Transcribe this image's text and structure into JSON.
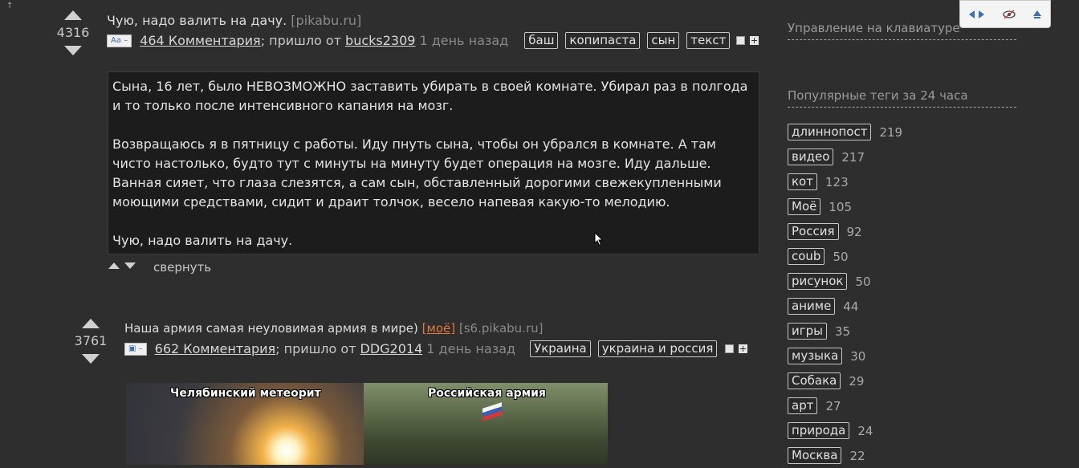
{
  "posts": [
    {
      "score": "4316",
      "title": "Чую, надо валить на дачу.",
      "source": "[pikabu.ru]",
      "type_badge": "Aa –",
      "comments": "464 Комментария",
      "from_text": "; пришло от",
      "author": "bucks2309",
      "time": "1 день назад",
      "tags": [
        "баш",
        "копипаста",
        "сын",
        "текст"
      ],
      "body": [
        "Сына, 16 лет, было НЕВОЗМОЖНО заставить убирать в своей комнате. Убирал раз в полгода и то только после интенсивного капания на мозг.",
        "Возвращаюсь я в пятницу с работы. Иду пнуть сына, чтобы он убрался в комнате. А там чисто настолько, будто тут с минуты на минуту будет операция на мозге. Иду дальше. Ванная сияет, что глаза слезятся, а сам сын, обставленный дорогими свежекупленными моющими средствами, сидит и драит толчок, весело напевая какую-то мелодию.",
        "Чую, надо валить на дачу."
      ],
      "collapse": "свернуть"
    },
    {
      "score": "3761",
      "title": "Наша армия самая неуловимая армия в мире)",
      "mine_label": "[моё]",
      "source": "[s6.pikabu.ru]",
      "type_badge": "▣ –",
      "comments": "662 Комментария",
      "from_text": "; пришло от",
      "author": "DDG2014",
      "time": "1 день назад",
      "tags": [
        "Украина",
        "украина и россия"
      ],
      "image_captions": [
        "Челябинский метеорит",
        "Российская армия"
      ]
    }
  ],
  "sidebar": {
    "keyboard_heading": "Управление на клавиатуре",
    "popular_heading": "Популярные теги за 24 часа",
    "popular_tags": [
      {
        "name": "длиннопост",
        "count": "219"
      },
      {
        "name": "видео",
        "count": "217"
      },
      {
        "name": "кот",
        "count": "123"
      },
      {
        "name": "Моё",
        "count": "105"
      },
      {
        "name": "Россия",
        "count": "92"
      },
      {
        "name": "coub",
        "count": "50"
      },
      {
        "name": "рисунок",
        "count": "50"
      },
      {
        "name": "аниме",
        "count": "44"
      },
      {
        "name": "игры",
        "count": "35"
      },
      {
        "name": "музыка",
        "count": "30"
      },
      {
        "name": "Собака",
        "count": "29"
      },
      {
        "name": "арт",
        "count": "27"
      },
      {
        "name": "природа",
        "count": "24"
      },
      {
        "name": "Москва",
        "count": "22"
      }
    ]
  },
  "colors": {
    "background": "#2e2e2e",
    "story_box": "#1c1c1c",
    "mine_tag": "#e07a3a"
  }
}
